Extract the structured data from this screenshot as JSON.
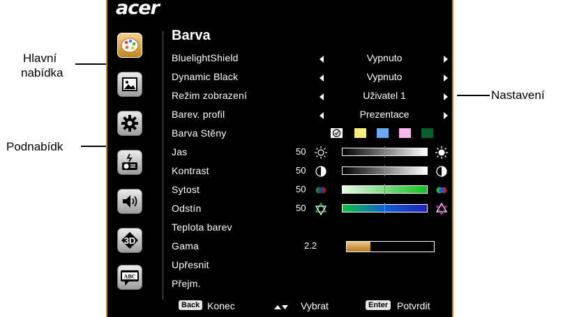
{
  "callouts": {
    "main_menu_line1": "Hlavní",
    "main_menu_line2": "nabídka",
    "submenu": "Podnabídk",
    "settings": "Nastavení"
  },
  "brand": "acer",
  "sidebar": {
    "items": [
      {
        "icon": "palette-icon",
        "selected": true
      },
      {
        "icon": "picture-icon",
        "selected": false
      },
      {
        "icon": "gear-icon",
        "selected": false
      },
      {
        "icon": "projector-icon",
        "selected": false
      },
      {
        "icon": "speaker-icon",
        "selected": false
      },
      {
        "icon": "3d-icon",
        "label": "3D",
        "selected": false
      },
      {
        "icon": "language-icon",
        "label": "ABC",
        "selected": false
      }
    ]
  },
  "panel": {
    "title": "Barva",
    "rows": [
      {
        "label": "BluelightShield",
        "value": "Vypnuto"
      },
      {
        "label": "Dynamic Black",
        "value": "Vypnuto"
      },
      {
        "label": "Režim zobrazení",
        "value": "Uživatel 1"
      },
      {
        "label": "Barev. profil",
        "value": "Prezentace"
      },
      {
        "label": "Barva Stěny",
        "swatches": [
          "#000000",
          "#f4ee7f",
          "#6aa8f2",
          "#f6b8ea",
          "#0d5d2c"
        ]
      },
      {
        "label": "Jas",
        "number": "50",
        "level": 0.5
      },
      {
        "label": "Kontrast",
        "number": "50",
        "level": 0.5
      },
      {
        "label": "Sytost",
        "number": "50",
        "level": 0.5
      },
      {
        "label": "Odstín",
        "number": "50",
        "level": 0.5
      },
      {
        "label": "Teplota barev"
      },
      {
        "label": "Gama",
        "value": "2.2",
        "level": 0.27
      },
      {
        "label": "Upřesnit"
      },
      {
        "label": "Přejm."
      }
    ]
  },
  "footer": {
    "back_key": "Back",
    "back_label": "Konec",
    "select_label": "Vybrat",
    "enter_key": "Enter",
    "enter_label": "Potvrdit"
  },
  "colors": {
    "frame": "#c08a2a",
    "selected": "#e0a640"
  }
}
